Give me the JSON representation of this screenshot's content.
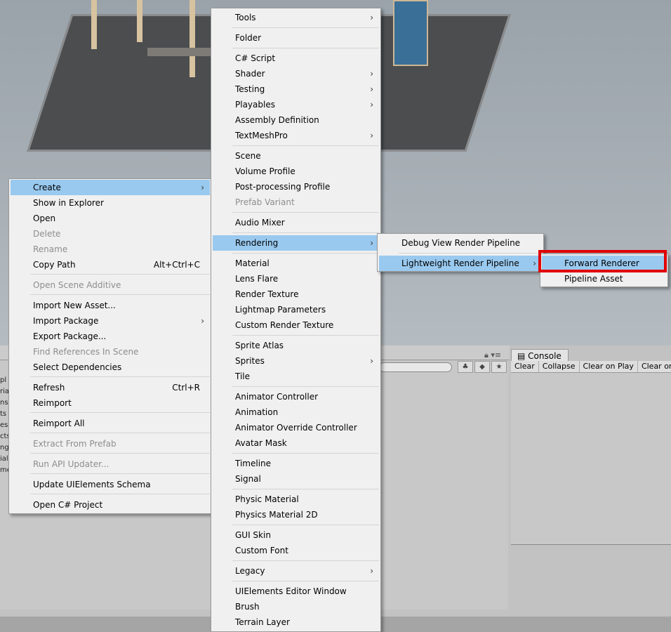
{
  "console": {
    "tab_label": "Console",
    "buttons": [
      "Clear",
      "Collapse",
      "Clear on Play",
      "Clear on"
    ]
  },
  "project": {
    "list_fragments": [
      "pl",
      "ria",
      "ns",
      "ts",
      "es",
      "cts",
      "ngs",
      "ial",
      "me"
    ]
  },
  "context_menu": [
    {
      "label": "Create",
      "submenu": true,
      "highlighted": true
    },
    {
      "label": "Show in Explorer"
    },
    {
      "label": "Open"
    },
    {
      "label": "Delete",
      "disabled": true
    },
    {
      "label": "Rename",
      "disabled": true
    },
    {
      "label": "Copy Path",
      "shortcut": "Alt+Ctrl+C"
    },
    {
      "label": "Open Scene Additive",
      "disabled": true
    },
    {
      "label": "Import New Asset..."
    },
    {
      "label": "Import Package",
      "submenu": true
    },
    {
      "label": "Export Package..."
    },
    {
      "label": "Find References In Scene",
      "disabled": true
    },
    {
      "label": "Select Dependencies"
    },
    {
      "label": "Refresh",
      "shortcut": "Ctrl+R"
    },
    {
      "label": "Reimport"
    },
    {
      "label": "Reimport All"
    },
    {
      "label": "Extract From Prefab",
      "disabled": true
    },
    {
      "label": "Run API Updater...",
      "disabled": true
    },
    {
      "label": "Update UIElements Schema"
    },
    {
      "label": "Open C# Project"
    }
  ],
  "create_menu": [
    {
      "label": "Tools",
      "submenu": true
    },
    {
      "label": "Folder"
    },
    {
      "label": "C# Script"
    },
    {
      "label": "Shader",
      "submenu": true
    },
    {
      "label": "Testing",
      "submenu": true
    },
    {
      "label": "Playables",
      "submenu": true
    },
    {
      "label": "Assembly Definition"
    },
    {
      "label": "TextMeshPro",
      "submenu": true
    },
    {
      "label": "Scene"
    },
    {
      "label": "Volume Profile"
    },
    {
      "label": "Post-processing Profile"
    },
    {
      "label": "Prefab Variant",
      "disabled": true
    },
    {
      "label": "Audio Mixer"
    },
    {
      "label": "Rendering",
      "submenu": true,
      "highlighted": true
    },
    {
      "label": "Material"
    },
    {
      "label": "Lens Flare"
    },
    {
      "label": "Render Texture"
    },
    {
      "label": "Lightmap Parameters"
    },
    {
      "label": "Custom Render Texture"
    },
    {
      "label": "Sprite Atlas"
    },
    {
      "label": "Sprites",
      "submenu": true
    },
    {
      "label": "Tile"
    },
    {
      "label": "Animator Controller"
    },
    {
      "label": "Animation"
    },
    {
      "label": "Animator Override Controller"
    },
    {
      "label": "Avatar Mask"
    },
    {
      "label": "Timeline"
    },
    {
      "label": "Signal"
    },
    {
      "label": "Physic Material"
    },
    {
      "label": "Physics Material 2D"
    },
    {
      "label": "GUI Skin"
    },
    {
      "label": "Custom Font"
    },
    {
      "label": "Legacy",
      "submenu": true
    },
    {
      "label": "UIElements Editor Window"
    },
    {
      "label": "Brush"
    },
    {
      "label": "Terrain Layer"
    }
  ],
  "rendering_menu": [
    {
      "label": "Debug View Render Pipeline"
    },
    {
      "label": "Lightweight Render Pipeline",
      "submenu": true,
      "highlighted": true
    }
  ],
  "lwrp_menu": [
    {
      "label": "Forward Renderer",
      "highlighted": true
    },
    {
      "label": "Pipeline Asset"
    }
  ],
  "colors": {
    "highlight": "#99c9ef",
    "annotation_box": "#e10000",
    "menu_bg": "#f0f0f0"
  }
}
